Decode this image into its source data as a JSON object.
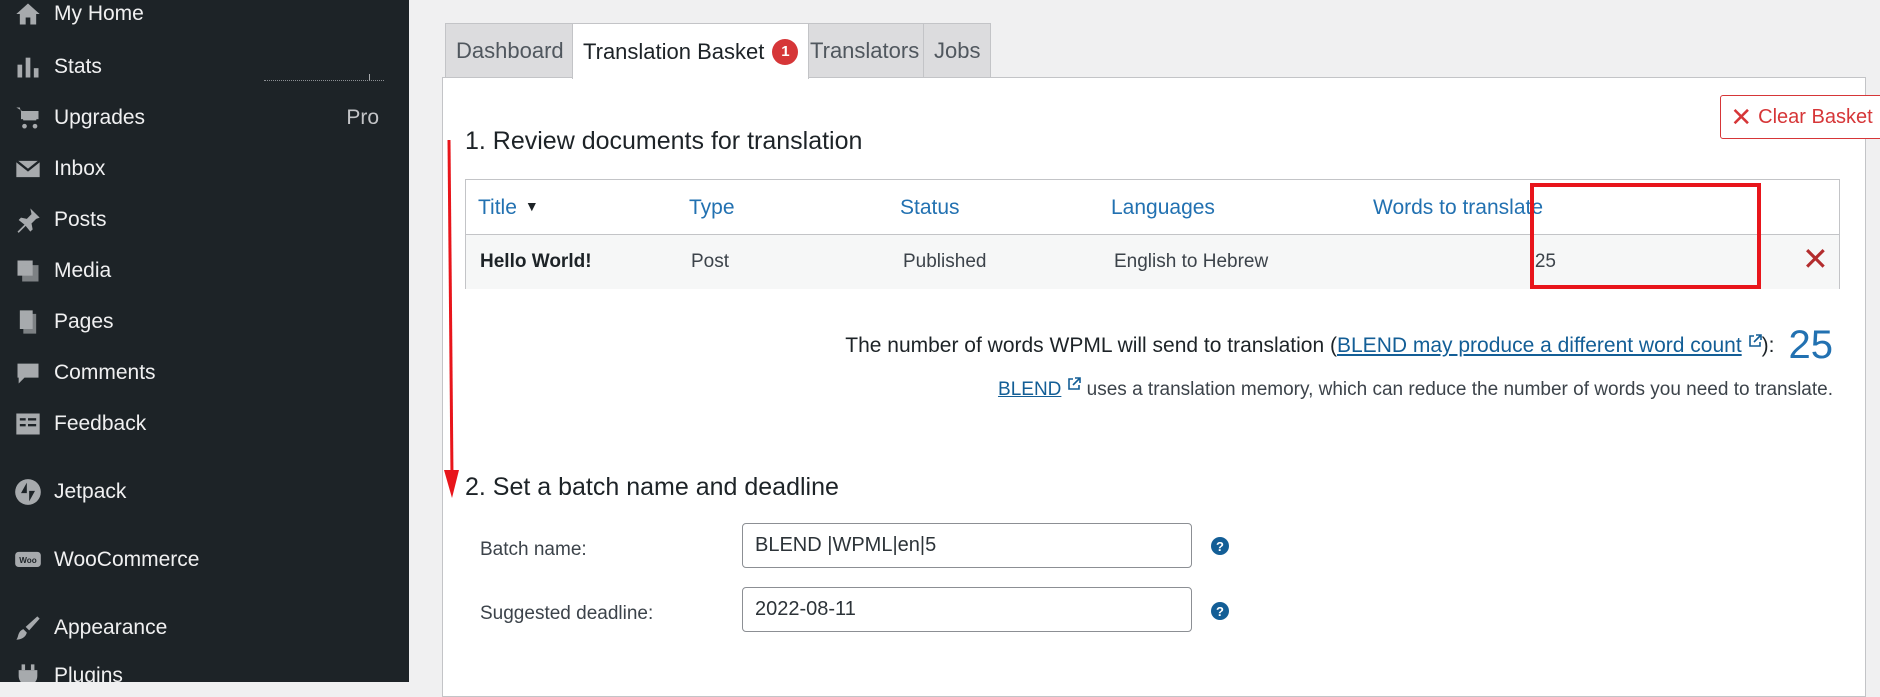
{
  "sidebar": {
    "items": [
      {
        "label": "My Home",
        "icon": "home-icon"
      },
      {
        "label": "Stats",
        "icon": "stats-bars-icon"
      },
      {
        "label": "Upgrades",
        "icon": "cart-icon",
        "badge": "Pro"
      },
      {
        "label": "Inbox",
        "icon": "envelope-icon"
      },
      {
        "label": "Posts",
        "icon": "pushpin-icon"
      },
      {
        "label": "Media",
        "icon": "media-icon"
      },
      {
        "label": "Pages",
        "icon": "pages-icon"
      },
      {
        "label": "Comments",
        "icon": "speech-bubble-icon"
      },
      {
        "label": "Feedback",
        "icon": "feedback-icon"
      },
      {
        "label": "Jetpack",
        "icon": "jetpack-bolt-icon"
      },
      {
        "label": "WooCommerce",
        "icon": "woo-icon"
      },
      {
        "label": "Appearance",
        "icon": "paintbrush-icon"
      },
      {
        "label": "Plugins",
        "icon": "plugin-icon"
      }
    ]
  },
  "tabs": [
    {
      "label": "Dashboard",
      "active": false
    },
    {
      "label": "Translation Basket",
      "active": true,
      "count": "1"
    },
    {
      "label": "Translators",
      "active": false
    },
    {
      "label": "Jobs",
      "active": false
    }
  ],
  "clear_basket_label": "Clear Basket",
  "section1_title": "1. Review documents for translation",
  "table": {
    "headers": {
      "title": "Title",
      "type": "Type",
      "status": "Status",
      "languages": "Languages",
      "words": "Words to translate"
    },
    "rows": [
      {
        "title": "Hello World!",
        "type": "Post",
        "status": "Published",
        "languages": "English to Hebrew",
        "words": "25"
      }
    ]
  },
  "wordcount": {
    "prefix": "The number of words WPML will send to translation (",
    "link": "BLEND may produce a different word count",
    "suffix": "):",
    "count": "25"
  },
  "memory": {
    "link": "BLEND",
    "text": "uses a translation memory, which can reduce the number of words you need to translate."
  },
  "section2_title": "2. Set a batch name and deadline",
  "form": {
    "batch_name_label": "Batch name:",
    "batch_name_value": "BLEND |WPML|en|5",
    "deadline_label": "Suggested deadline:",
    "deadline_value": "2022-08-11",
    "help_glyph": "?"
  },
  "colors": {
    "sidebar_bg": "#1d2327",
    "link_blue": "#2271b1",
    "danger_red": "#d63638",
    "annotation_red": "#e8151b"
  }
}
